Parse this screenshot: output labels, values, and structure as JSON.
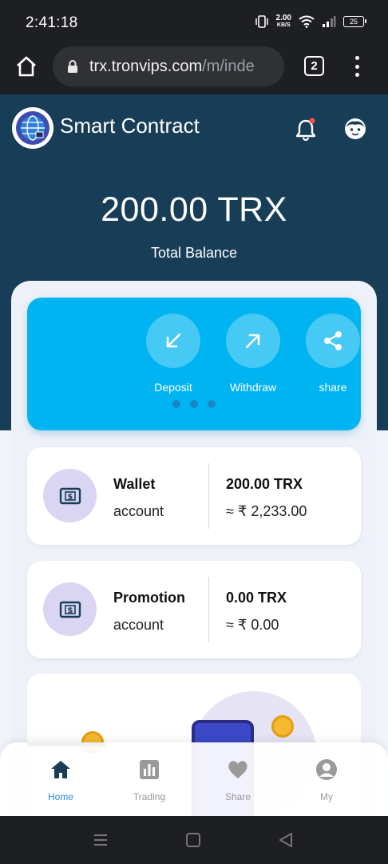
{
  "status_bar": {
    "time": "2:41:18",
    "net_speed": "2.00",
    "net_unit": "KB/S",
    "battery": "25"
  },
  "browser": {
    "url_host": "trx.tronvips.com",
    "url_path": "/m/inde",
    "tab_count": "2"
  },
  "header": {
    "title": "Smart Contract"
  },
  "balance": {
    "amount": "200.00 TRX",
    "label": "Total Balance"
  },
  "actions": [
    {
      "label": "Deposit",
      "icon": "arrow-down-left-icon"
    },
    {
      "label": "Withdraw",
      "icon": "arrow-up-right-icon"
    },
    {
      "label": "share",
      "icon": "share-icon"
    }
  ],
  "carousel": {
    "pages": 3,
    "active": 0
  },
  "accounts": [
    {
      "name": "Wallet",
      "sub": "account",
      "amount": "200.00 TRX",
      "converted": "≈ ₹ 2,233.00"
    },
    {
      "name": "Promotion",
      "sub": "account",
      "amount": "0.00 TRX",
      "converted": "≈ ₹ 0.00"
    }
  ],
  "bottom_nav": [
    {
      "label": "Home",
      "icon": "home-icon",
      "active": true
    },
    {
      "label": "Trading",
      "icon": "bar-chart-icon",
      "active": false
    },
    {
      "label": "Share",
      "icon": "heart-icon",
      "active": false
    },
    {
      "label": "My",
      "icon": "user-circle-icon",
      "active": false
    }
  ],
  "colors": {
    "header_bg": "#183d57",
    "action_card": "#00b4f1",
    "icon_circle": "#d9d5f3",
    "nav_active": "#2b8de6",
    "nav_active_icon": "#183d57",
    "nav_inactive": "#9a9a9a"
  }
}
